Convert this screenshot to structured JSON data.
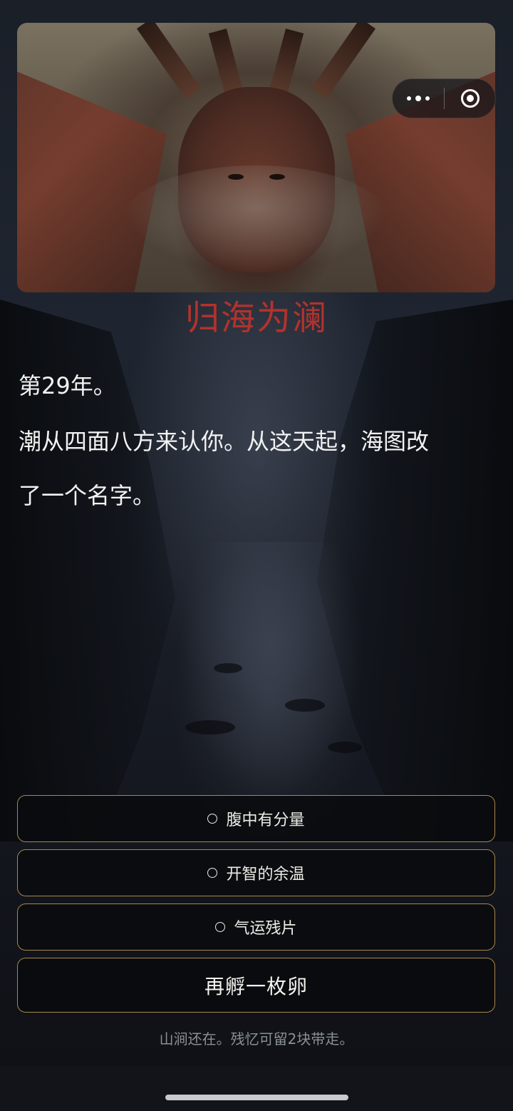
{
  "title": "归海为澜",
  "story": {
    "year": "第29年。",
    "line1": "潮从四面八方来认你。从这天起，海图改",
    "line2": "了一个名字。"
  },
  "options": [
    {
      "label": "腹中有分量"
    },
    {
      "label": "开智的余温"
    },
    {
      "label": "气运残片"
    }
  ],
  "primary_button": "再孵一枚卵",
  "footnote": "山涧还在。残忆可留2块带走。",
  "capsule": {
    "more_icon": "more-dots-icon",
    "close_icon": "miniprogram-close-icon"
  },
  "colors": {
    "title": "#b3322c",
    "button_border": "#a8884a",
    "text": "#f2f2f2",
    "footnote": "#8b8f96"
  }
}
